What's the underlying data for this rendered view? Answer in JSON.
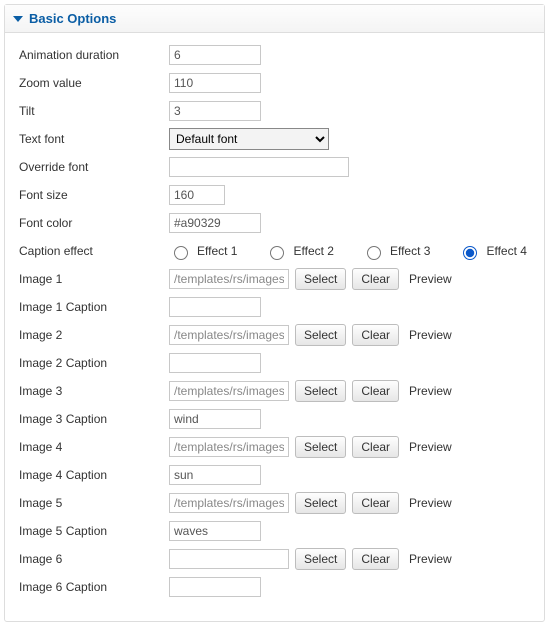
{
  "panel": {
    "title": "Basic Options"
  },
  "fields": {
    "animation_duration": {
      "label": "Animation duration",
      "value": "6"
    },
    "zoom_value": {
      "label": "Zoom value",
      "value": "110"
    },
    "tilt": {
      "label": "Tilt",
      "value": "3"
    },
    "text_font": {
      "label": "Text font",
      "selected": "Default font"
    },
    "override_font": {
      "label": "Override font",
      "value": ""
    },
    "font_size": {
      "label": "Font size",
      "value": "160"
    },
    "font_color": {
      "label": "Font color",
      "value": "#a90329"
    },
    "caption_effect": {
      "label": "Caption effect",
      "options": [
        "Effect 1",
        "Effect 2",
        "Effect 3",
        "Effect 4"
      ],
      "selected": "Effect 4"
    },
    "buttons": {
      "select": "Select",
      "clear": "Clear",
      "preview": "Preview"
    },
    "image1": {
      "label": "Image 1",
      "value": "/templates/rs/images/"
    },
    "image1_caption": {
      "label": "Image 1 Caption",
      "value": ""
    },
    "image2": {
      "label": "Image 2",
      "value": "/templates/rs/images/"
    },
    "image2_caption": {
      "label": "Image 2 Caption",
      "value": ""
    },
    "image3": {
      "label": "Image 3",
      "value": "/templates/rs/images/"
    },
    "image3_caption": {
      "label": "Image 3 Caption",
      "value": "wind"
    },
    "image4": {
      "label": "Image 4",
      "value": "/templates/rs/images/"
    },
    "image4_caption": {
      "label": "Image 4 Caption",
      "value": "sun"
    },
    "image5": {
      "label": "Image 5",
      "value": "/templates/rs/images/"
    },
    "image5_caption": {
      "label": "Image 5 Caption",
      "value": "waves"
    },
    "image6": {
      "label": "Image 6",
      "value": ""
    },
    "image6_caption": {
      "label": "Image 6 Caption",
      "value": ""
    }
  }
}
